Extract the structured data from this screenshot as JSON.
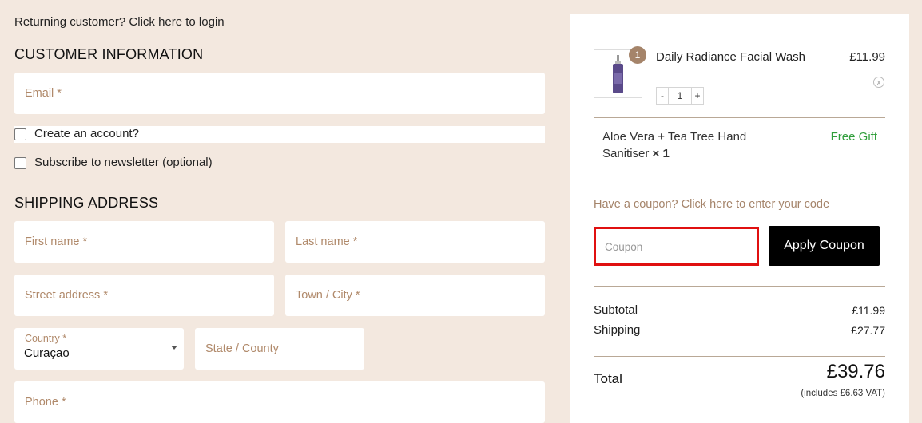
{
  "login_prompt": "Returning customer? Click here to login",
  "customer": {
    "title": "CUSTOMER INFORMATION",
    "email_placeholder": "Email *",
    "create_account": "Create an account?",
    "newsletter": "Subscribe to newsletter (optional)"
  },
  "shipping": {
    "title": "SHIPPING ADDRESS",
    "first_name": "First name *",
    "last_name": "Last name *",
    "street": "Street address *",
    "town": "Town / City *",
    "country_label": "Country *",
    "country_value": "Curaçao",
    "state": "State / County",
    "phone": "Phone *"
  },
  "cart": {
    "item": {
      "badge": "1",
      "name": "Daily Radiance Facial Wash",
      "price": "£11.99",
      "remove": "x",
      "qty_minus": "-",
      "qty": "1",
      "qty_plus": "+"
    },
    "gift": {
      "name": "Aloe Vera + Tea Tree Hand Sanitiser",
      "qty": "× 1",
      "tag": "Free Gift"
    },
    "coupon_link": "Have a coupon? Click here to enter your code",
    "coupon_placeholder": "Coupon",
    "apply_label": "Apply Coupon",
    "subtotal_label": "Subtotal",
    "subtotal": "£11.99",
    "shipping_label": "Shipping",
    "shipping": "£27.77",
    "total_label": "Total",
    "total": "£39.76",
    "vat_note": "(includes £6.63 VAT)"
  },
  "colors": {
    "page_bg": "#f3e8df",
    "accent": "#a5846a",
    "gift_green": "#2f9e3a",
    "highlight_red": "#e01010"
  }
}
